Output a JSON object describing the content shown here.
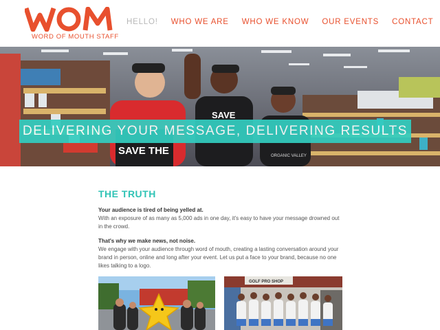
{
  "logo": {
    "wordmark": "WOM",
    "tagline": "WORD OF MOUTH STAFF"
  },
  "nav": {
    "items": [
      {
        "label": "HELLO!",
        "active": true
      },
      {
        "label": "WHO WE ARE",
        "active": false
      },
      {
        "label": "WHO WE KNOW",
        "active": false
      },
      {
        "label": "OUR EVENTS",
        "active": false
      },
      {
        "label": "CONTACT",
        "active": false
      }
    ]
  },
  "hero": {
    "banner": "DELIVERING YOUR MESSAGE, DELIVERING RESULTS",
    "shirt_text_1": "SAVE THE",
    "shirt_text_2": "SAVE",
    "shirt_text_3": "ORGANIC VALLEY"
  },
  "main": {
    "title": "THE TRUTH",
    "p1_head": "Your audience is tired of being yelled at.",
    "p1_body": "With an exposure of as many as 5,000 ads in one day, it's easy to have your message drowned out in the crowd.",
    "p2_head": "That's why we make news, not noise.",
    "p2_body": "We engage with your audience through word of mouth, creating a lasting conversation around your brand in person, online and long after your event. Let us put a face to your brand, because no one likes talking to a logo."
  },
  "photos": {
    "sign_text": "GOLF PRO SHOP"
  },
  "colors": {
    "accent": "#e8502e",
    "teal": "#33cdc0",
    "muted": "#b8b8b8"
  }
}
